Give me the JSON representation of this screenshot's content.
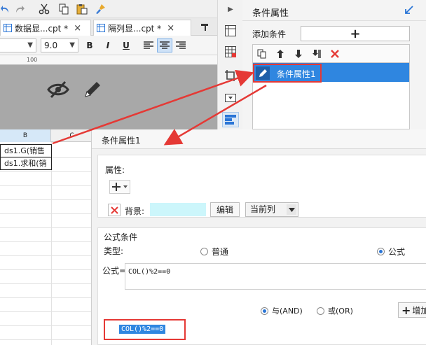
{
  "left": {
    "tabs": [
      {
        "label": "数据显...cpt *",
        "close": "×"
      },
      {
        "label": "隔列显...cpt *",
        "close": "×"
      }
    ],
    "font_size": "9.0",
    "bold": "B",
    "italic": "I",
    "underline": "U",
    "ruler_mark": "100",
    "columns": [
      "B",
      "C"
    ],
    "cells": [
      "ds1.G(销售",
      "ds1.求和(销"
    ]
  },
  "panel": {
    "title": "条件属性",
    "add_condition_label": "添加条件",
    "add_symbol": "+",
    "list_item": "条件属性1"
  },
  "dialog": {
    "name": "条件属性1",
    "attr_label": "属性:",
    "bg_label": "背景:",
    "bg_color": "#ccf6fb",
    "edit_button": "编辑",
    "scope_value": "当前列",
    "formula_group": "公式条件",
    "type_label": "类型:",
    "type_options": [
      "普通",
      "公式"
    ],
    "formula_label": "公式=",
    "formula_value": "COL()%2==0",
    "logic_and": "与(AND)",
    "logic_or": "或(OR)",
    "add_label": "增加",
    "result_formula": "COL()%2==0"
  },
  "colors": {
    "accent": "#2a75d6",
    "highlight": "#e53935",
    "selected": "#2f86e0"
  }
}
